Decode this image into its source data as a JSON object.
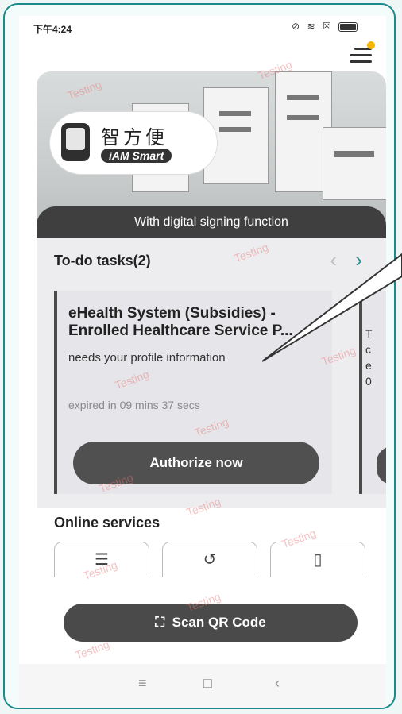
{
  "status_bar": {
    "time": "下午4:24"
  },
  "banner": {
    "logo_cn": "智方便",
    "logo_en": "iAM Smart",
    "caption": "With digital signing function"
  },
  "todo": {
    "header": "To-do tasks(2)",
    "card": {
      "title_line1": "eHealth System (Subsidies) -",
      "title_line2": "Enrolled Healthcare Service P...",
      "subtitle": "needs your profile information",
      "expiry": "expired in 09 mins 37 secs",
      "button": "Authorize now"
    },
    "peek_text": "T\nc\ne\n0"
  },
  "online_services": {
    "title": "Online services"
  },
  "scan": {
    "label": "Scan QR Code"
  },
  "watermark": "Testing",
  "colors": {
    "accent": "#2a8f8f",
    "dark_button": "#4a4a4a",
    "frame": "#1d8a8a"
  }
}
